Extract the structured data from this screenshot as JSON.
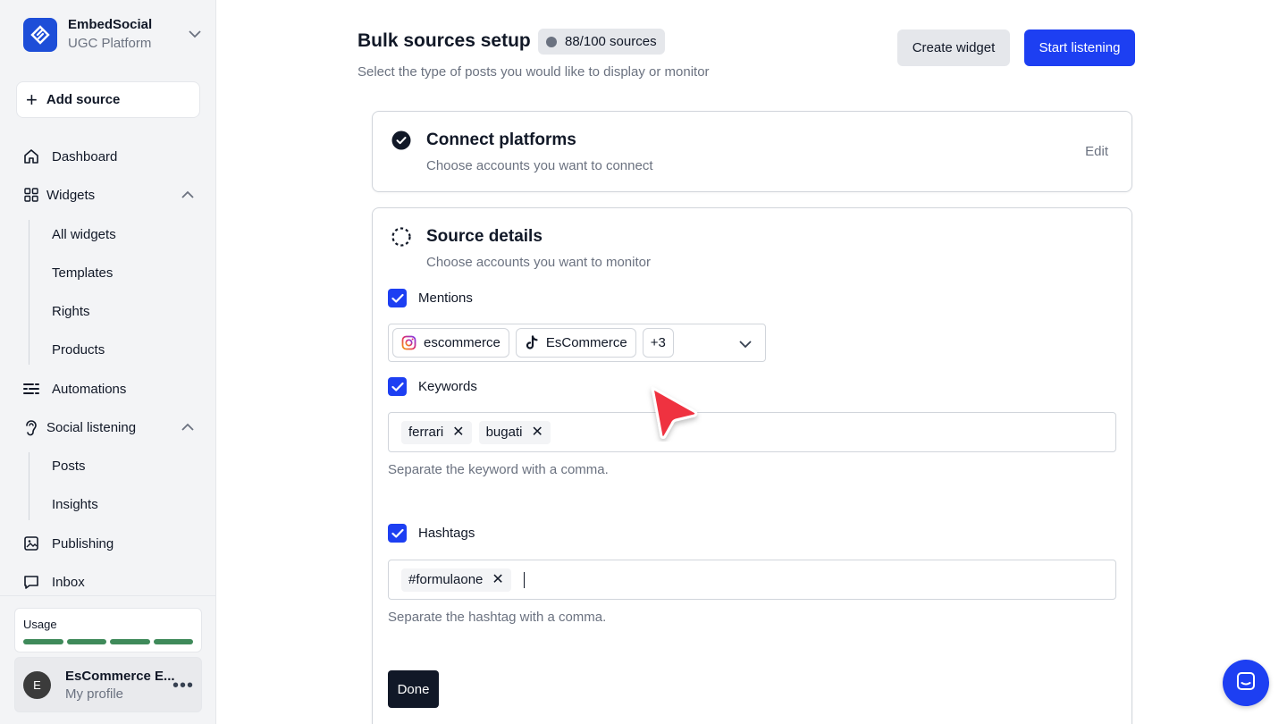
{
  "brand": {
    "name": "EmbedSocial",
    "subtitle": "UGC Platform"
  },
  "sidebar": {
    "add_source": "Add source",
    "items": {
      "dashboard": "Dashboard",
      "widgets": "Widgets",
      "all_widgets": "All widgets",
      "templates": "Templates",
      "rights": "Rights",
      "products": "Products",
      "automations": "Automations",
      "social_listening": "Social listening",
      "posts": "Posts",
      "insights": "Insights",
      "publishing": "Publishing",
      "inbox": "Inbox"
    },
    "usage": {
      "label": "Usage",
      "bars_filled": 4
    },
    "profile": {
      "initial": "E",
      "name": "EsCommerce E...",
      "sub": "My profile"
    }
  },
  "header": {
    "title": "Bulk sources setup",
    "badge": "88/100 sources",
    "subtitle": "Select the type of posts you would like to display or monitor",
    "create_widget": "Create widget",
    "start_listening": "Start listening"
  },
  "step1": {
    "title": "Connect platforms",
    "subtitle": "Choose accounts you want to connect",
    "edit": "Edit"
  },
  "step2": {
    "title": "Source details",
    "subtitle": "Choose accounts you want to monitor",
    "mentions": {
      "label": "Mentions",
      "checked": true,
      "accounts": [
        {
          "platform": "instagram-icon",
          "name": "escommerce"
        },
        {
          "platform": "tiktok-icon",
          "name": "EsCommerce"
        }
      ],
      "more": "+3"
    },
    "keywords": {
      "label": "Keywords",
      "checked": true,
      "tags": [
        "ferrari",
        "bugati"
      ],
      "hint": "Separate the keyword with a comma."
    },
    "hashtags": {
      "label": "Hashtags",
      "checked": true,
      "tags": [
        "#formulaone"
      ],
      "hint": "Separate the hashtag with a comma."
    },
    "done": "Done"
  },
  "colors": {
    "accent": "#1d3ff2",
    "usage_bar": "#3f8a5a",
    "cursor": "#ef3340"
  }
}
